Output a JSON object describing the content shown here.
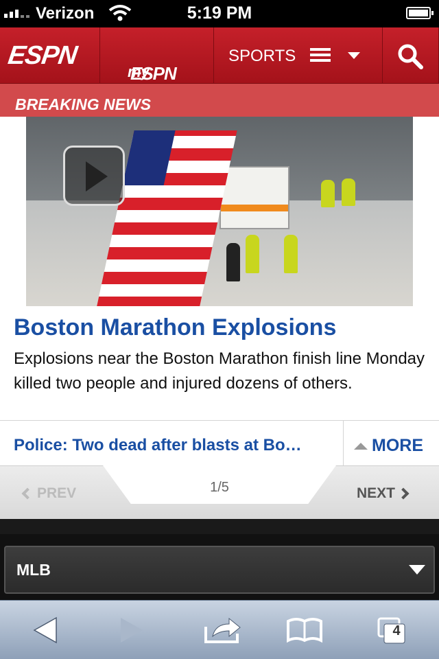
{
  "status_bar": {
    "carrier": "Verizon",
    "time": "5:19 PM"
  },
  "nav": {
    "logo": "ESPN",
    "my_prefix": "my",
    "my_logo": "ESPN",
    "sports_label": "SPORTS"
  },
  "breaking": {
    "label": "BREAKING NEWS"
  },
  "story": {
    "headline": "Boston Marathon Explosions",
    "description": "Explosions near the Boston Marathon finish line Monday killed two people and injured dozens of others.",
    "related_link": "Police: Two dead after blasts at Bo…",
    "more_label": "MORE"
  },
  "pager": {
    "prev_label": "PREV",
    "next_label": "NEXT",
    "counter": "1/5"
  },
  "league_select": {
    "value": "MLB"
  },
  "toolbar": {
    "tabs_count": "4"
  },
  "colors": {
    "espn_red": "#c5202a",
    "breaking_red": "#d24a4c",
    "link_blue": "#1a4fa3"
  }
}
